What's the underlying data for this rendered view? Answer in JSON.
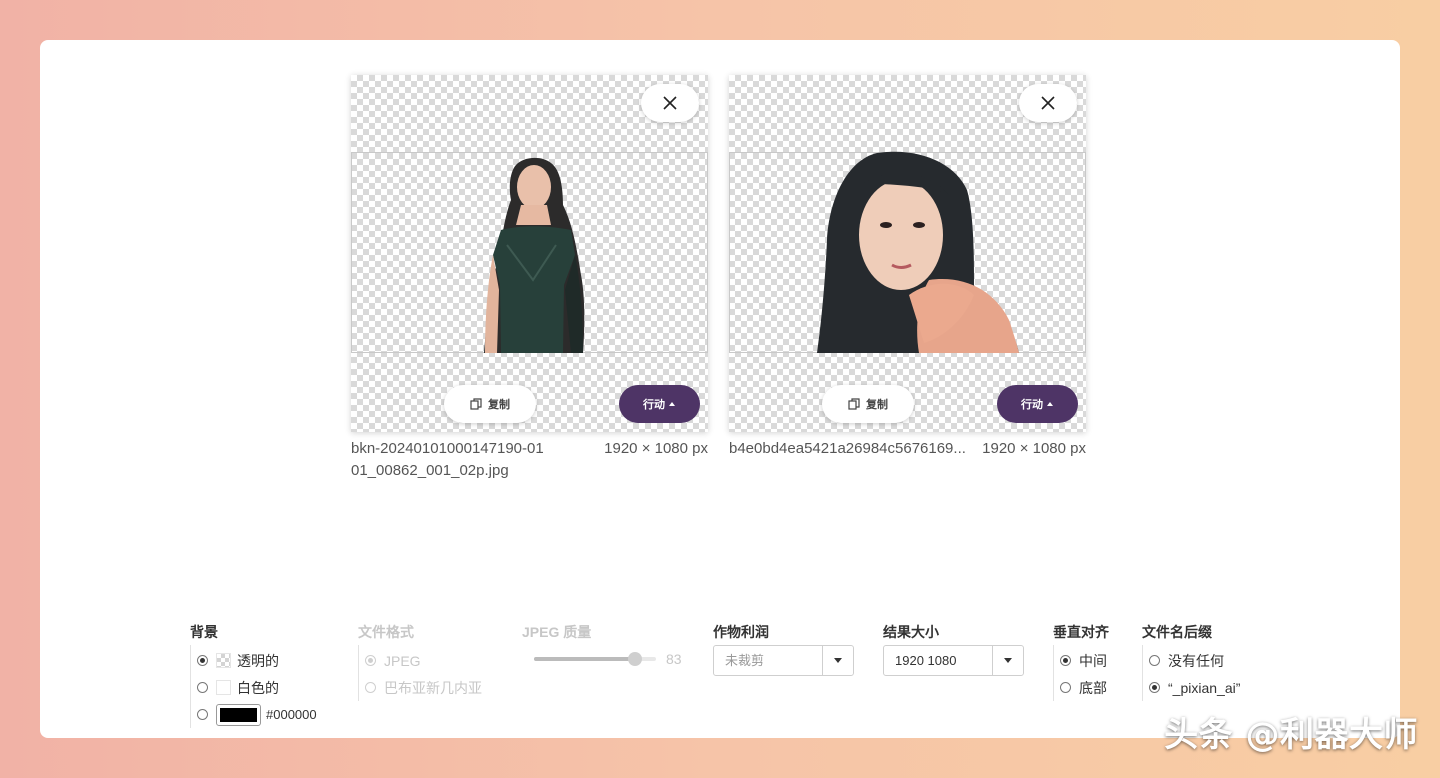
{
  "cards": [
    {
      "filename": "bkn-20240101000147190-0101_00862_001_02p.jpg",
      "dims": "1920 × 1080 px",
      "copy_label": "复制",
      "action_label": "行动"
    },
    {
      "filename": "b4e0bd4ea5421a26984c5676169...",
      "dims": "1920 × 1080 px",
      "copy_label": "复制",
      "action_label": "行动"
    }
  ],
  "options": {
    "background": {
      "label": "背景",
      "transparent": "透明的",
      "white": "白色的",
      "color_value": "#000000",
      "selected": "transparent"
    },
    "format": {
      "label": "文件格式",
      "jpeg": "JPEG",
      "png": "巴布亚新几内亚",
      "selected": "jpeg",
      "disabled": true
    },
    "quality": {
      "label": "JPEG 质量",
      "value": "83",
      "fraction": 0.83
    },
    "crop": {
      "label": "作物利润",
      "placeholder": "未裁剪"
    },
    "size": {
      "label": "结果大小",
      "value": "1920 1080"
    },
    "valign": {
      "label": "垂直对齐",
      "middle": "中间",
      "bottom": "底部",
      "selected": "middle"
    },
    "suffix": {
      "label": "文件名后缀",
      "none": "没有任何",
      "pixian": "“_pixian_ai”",
      "selected": "pixian"
    }
  },
  "watermark": "头条 @利器大师",
  "colors": {
    "accent": "#4e3466",
    "background_gradient_start": "#f1b2a6",
    "background_gradient_end": "#f8cea3"
  }
}
